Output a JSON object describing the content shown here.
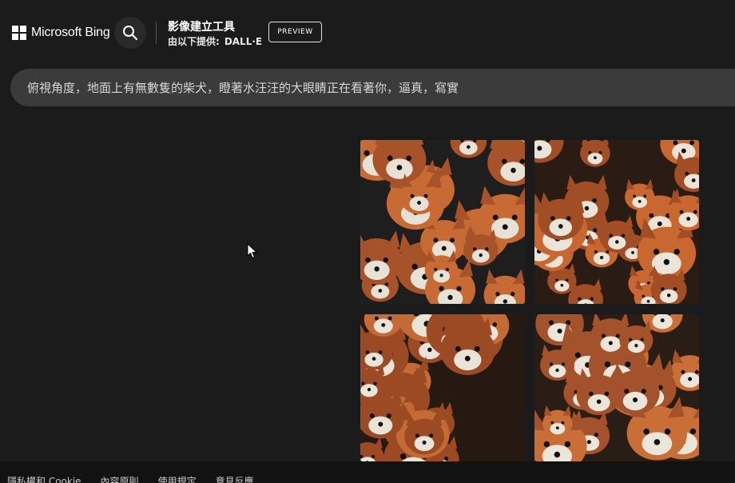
{
  "header": {
    "brand_name": "Microsoft Bing",
    "tool_title": "影像建立工具",
    "tool_subtitle_prefix": "由以下提供:",
    "tool_provider": "DALL·E",
    "preview_label": "PREVIEW"
  },
  "icons": {
    "logo": "microsoft-logo-icon",
    "search": "search-icon",
    "cursor": "mouse-pointer-icon"
  },
  "prompt": {
    "text": "俯視角度，地面上有無數隻的柴犬，瞪著水汪汪的大眼睛正在看著你，逼真，寫實"
  },
  "images": [
    {
      "palette": [
        "#c86a33",
        "#a8522a",
        "#e8e1d6",
        "#1e1e1e"
      ]
    },
    {
      "palette": [
        "#c8672f",
        "#a14d26",
        "#ebe4d9",
        "#2a1c14"
      ]
    },
    {
      "palette": [
        "#c46a35",
        "#9c4a24",
        "#eae3d8",
        "#261912"
      ]
    },
    {
      "palette": [
        "#ca6e38",
        "#a4522b",
        "#ece5da",
        "#2a1d15"
      ]
    }
  ],
  "footer": {
    "links": [
      "隱私權和 Cookie",
      "內容原則",
      "使用規定",
      "意見反應"
    ]
  },
  "colors": {
    "background": "#1b1b1b",
    "prompt_bar": "#3b3b3b",
    "footer": "#121212"
  }
}
